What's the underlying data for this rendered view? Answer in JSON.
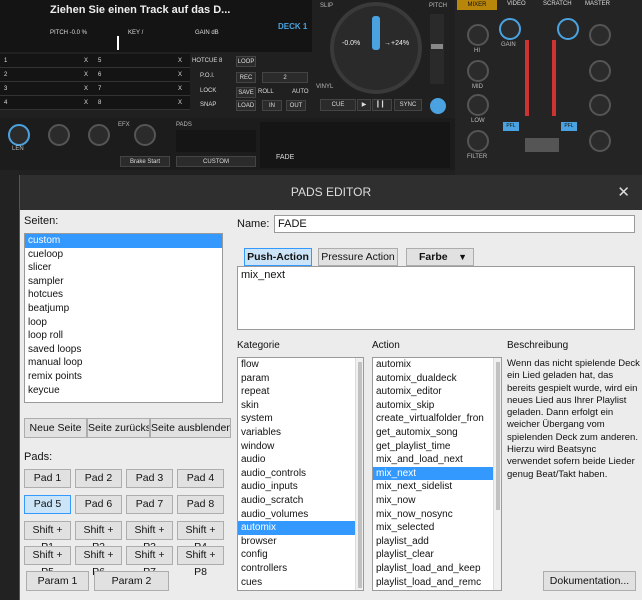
{
  "dj": {
    "track_title": "Ziehen Sie einen Track auf das D...",
    "pitch_label": "PITCH -0.0 %",
    "key_label": "KEY  /",
    "gain_label": "GAIN  dB",
    "deck_label": "DECK 1",
    "slip": "SLIP",
    "pitch_right": "PITCH",
    "pitch_value": "-0.0%",
    "pitch_range": "→+24%",
    "vinyl": "VINYL",
    "cue": "CUE",
    "play": "▶",
    "stutter": "▎▎",
    "sync": "SYNC",
    "tabs": [
      "MIXER",
      "VIDEO",
      "SCRATCH",
      "MASTER"
    ],
    "hotcue_rows": [
      {
        "n": "1",
        "x": "X",
        "n2": "5"
      },
      {
        "n": "2",
        "x": "X",
        "n2": "6"
      },
      {
        "n": "3",
        "x": "X",
        "n2": "7"
      },
      {
        "n": "4",
        "x": "X",
        "n2": "8"
      }
    ],
    "hotcue_labels": [
      "HOTCUE 8",
      "P.O.I.",
      "LOCK",
      "SNAP"
    ],
    "loop_labels": [
      "LOOP",
      "REC",
      "SAVE",
      "LOAD"
    ],
    "loop_value": "2",
    "roll": "ROLL",
    "auto": "AUTO",
    "in": "IN",
    "out": "OUT",
    "mixer_labels": [
      "HI",
      "MID",
      "LOW",
      "FILTER",
      "GAIN",
      "PFL"
    ],
    "len": "LEN",
    "efx": "EFX",
    "pads_label": "PADS",
    "brake": "Brake Start",
    "custom": "CUSTOM",
    "fade": "FADE"
  },
  "dialog": {
    "title": "PADS EDITOR",
    "close": "✕",
    "seiten_label": "Seiten:",
    "seiten": [
      "custom",
      "cueloop",
      "slicer",
      "sampler",
      "hotcues",
      "beatjump",
      "loop",
      "loop roll",
      "saved loops",
      "manual loop",
      "remix points",
      "keycue"
    ],
    "seiten_selected": 0,
    "buttons": {
      "new_page": "Neue Seite",
      "reset_page": "Seite zurücksetzen",
      "hide_page": "Seite ausblenden"
    },
    "pads_label": "Pads:",
    "pads": [
      "Pad 1",
      "Pad 2",
      "Pad 3",
      "Pad 4",
      "Pad 5",
      "Pad 6",
      "Pad 7",
      "Pad 8",
      "Shift + P1",
      "Shift + P2",
      "Shift + P3",
      "Shift + P4",
      "Shift + P5",
      "Shift + P6",
      "Shift + P7",
      "Shift + P8"
    ],
    "pad_selected": 4,
    "params": [
      "Param 1",
      "Param 2"
    ],
    "name_label": "Name:",
    "name_value": "FADE",
    "tabs": {
      "push": "Push-Action",
      "pressure": "Pressure Action",
      "color": "Farbe"
    },
    "script": "mix_next",
    "kategorie_label": "Kategorie",
    "kategorie": [
      "flow",
      "param",
      "repeat",
      "skin",
      "system",
      "variables",
      "window",
      "audio",
      "audio_controls",
      "audio_inputs",
      "audio_scratch",
      "audio_volumes",
      "automix",
      "browser",
      "config",
      "controllers",
      "cues"
    ],
    "kategorie_selected": 12,
    "action_label": "Action",
    "actions": [
      "automix",
      "automix_dualdeck",
      "automix_editor",
      "automix_skip",
      "create_virtualfolder_fron",
      "get_automix_song",
      "get_playlist_time",
      "mix_and_load_next",
      "mix_next",
      "mix_next_sidelist",
      "mix_now",
      "mix_now_nosync",
      "mix_selected",
      "playlist_add",
      "playlist_clear",
      "playlist_load_and_keep",
      "playlist_load_and_remc"
    ],
    "action_selected": 8,
    "beschreibung_label": "Beschreibung",
    "beschreibung": "Wenn das nicht spielende Deck ein Lied geladen hat, das bereits gespielt wurde, wird ein neues Lied aus Ihrer Playlist geladen. Dann erfolgt ein weicher Übergang vom spielenden Deck zum anderen. Hierzu wird Beatsync verwendet sofern beide Lieder genug Beat/Takt haben.",
    "doc_button": "Dokumentation...",
    "colors": {
      "accent": "#3399ff",
      "title_bar": "#2f2f2f",
      "deck_blue": "#4aa3e0"
    }
  }
}
